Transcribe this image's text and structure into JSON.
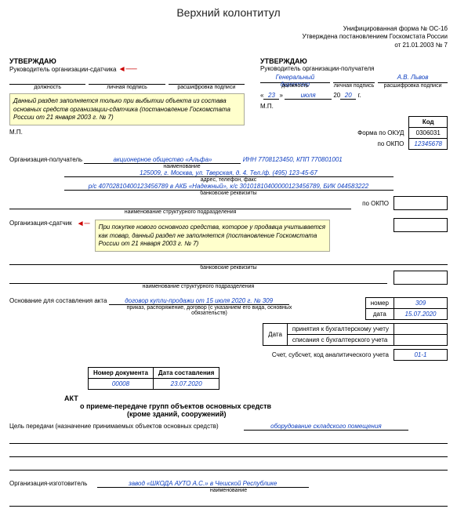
{
  "header": {
    "title": "Верхний колонтитул",
    "form": "Унифицированная форма № ОС-1б",
    "approved": "Утверждена постановлением Госкомстата России",
    "date": "от 21.01.2003 № 7"
  },
  "left": {
    "approve": "УТВЕРЖДАЮ",
    "head": "Руководитель организации-сдатчика",
    "post_s": "должность",
    "sig_s": "личная подпись",
    "name_s": "расшифровка подписи",
    "note": "Данный раздел заполняется только при выбытии объекта из состава основных средств организации-сдатчика (постановление Госкомстата России от 21 января 2003 г. № 7)",
    "mp": "М.П."
  },
  "right": {
    "approve": "УТВЕРЖДАЮ",
    "head": "Руководитель организации-получателя",
    "director": "Генеральный директор",
    "name": "А.В. Львов",
    "post_s": "должность",
    "sig_s": "личная подпись",
    "name_s": "расшифровка подписи",
    "day": "23",
    "month": "июля",
    "y1": "20",
    "y2": "20",
    "g": "г."
  },
  "codes": {
    "code_h": "Код",
    "okud_l": "Форма по ОКУД",
    "okud": "0306031",
    "okpo_l": "по ОКПО",
    "okpo1": "12345678",
    "okpo_l2": "по ОКПО"
  },
  "recipient": {
    "label": "Организация-получатель",
    "value": "акционерное общество «Альфа»",
    "inn": "ИНН 7708123450, КПП 770801001",
    "sub": "наименование",
    "addr": "125009, г. Москва, ул. Тверская, д. 4. Тел./ф. (495) 123-45-67",
    "addr_sub": "адрес, телефон, факс",
    "bank": "р/с 40702810400123456789 в АКБ «Надежный», к/с 30101810400000123456789, БИК 044583222",
    "bank_sub": "банковские реквизиты",
    "unit_sub": "наименование структурного подразделения"
  },
  "sender": {
    "label": "Организация-сдатчик",
    "note": "При покупке нового основного средства, которое у продавца учитывается как товар, данный раздел не заполняется (постановление Госкомстата России от 21 января 2003 г. № 7)",
    "bank_sub": "банковские реквизиты",
    "unit_sub": "наименование структурного подразделения"
  },
  "basis": {
    "label": "Основание для составления акта",
    "value": "договор купли-продажи от 15 июля 2020 г. № 309",
    "sub": "приказ, распоряжение, договор (с указанием его вида, основных обязательств)",
    "num_l": "номер",
    "num": "309",
    "date_l": "дата",
    "date": "15.07.2020",
    "date_box_l": "Дата",
    "accept": "принятия к бухгалтерскому учету",
    "writeoff": "списания с бухгалтерского учета",
    "account_l": "Счет, субсчет, код аналитического учета",
    "account": "01-1"
  },
  "doc": {
    "num_l": "Номер документа",
    "num": "00008",
    "date_l": "Дата составления",
    "date": "23.07.2020"
  },
  "act": {
    "akt": "АКТ",
    "title": "о приеме-передаче групп объектов основных средств",
    "sub": "(кроме зданий, сооружений)"
  },
  "purpose": {
    "label": "Цель передачи (назначение принимаемых объектов основных средств)",
    "value": "оборудование складского помещения"
  },
  "maker": {
    "label": "Организация-изготовитель",
    "value": "завод «ШКОДА АУТО А.С.» в Чешской Республике",
    "sub": "наименование"
  }
}
